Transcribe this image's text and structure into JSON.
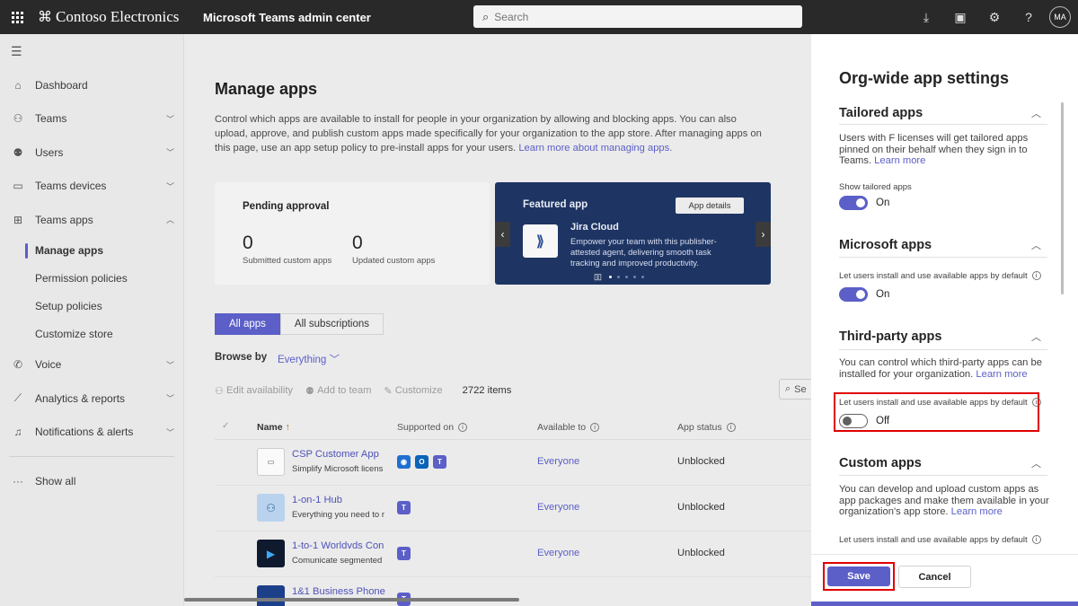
{
  "topbar": {
    "org_name": "Contoso Electronics",
    "product_name": "Microsoft Teams admin center",
    "search_placeholder": "Search",
    "avatar_initials": "MA"
  },
  "sidebar": {
    "items": [
      {
        "label": "Dashboard"
      },
      {
        "label": "Teams"
      },
      {
        "label": "Users"
      },
      {
        "label": "Teams devices"
      },
      {
        "label": "Teams apps"
      },
      {
        "label": "Voice"
      },
      {
        "label": "Analytics & reports"
      },
      {
        "label": "Notifications & alerts"
      }
    ],
    "subitems": [
      {
        "label": "Manage apps"
      },
      {
        "label": "Permission policies"
      },
      {
        "label": "Setup policies"
      },
      {
        "label": "Customize store"
      }
    ],
    "show_all": "Show all"
  },
  "main": {
    "title": "Manage apps",
    "description": "Control which apps are available to install for people in your organization by allowing and blocking apps. You can also upload, approve, and publish custom apps made specifically for your organization to the app store. After managing apps on this page, use an app setup policy to pre-install apps for your users.",
    "learn_more": "Learn more about managing apps.",
    "pending": {
      "title": "Pending approval",
      "submitted_count": "0",
      "submitted_label": "Submitted custom apps",
      "updated_count": "0",
      "updated_label": "Updated custom apps"
    },
    "featured": {
      "title": "Featured app",
      "button": "App details",
      "app_name": "Jira Cloud",
      "app_desc": "Empower your team with this publisher-attested agent, delivering smooth task tracking and improved productivity."
    },
    "tabs": [
      {
        "label": "All apps"
      },
      {
        "label": "All subscriptions"
      }
    ],
    "browse_label": "Browse by",
    "browse_value": "Everything",
    "toolbar": {
      "edit_availability": "Edit availability",
      "add_to_team": "Add to team",
      "customize": "Customize",
      "item_count": "2722 items",
      "search_partial": "Se"
    },
    "columns": {
      "name": "Name",
      "supported_on": "Supported on",
      "available_to": "Available to",
      "app_status": "App status"
    },
    "rows": [
      {
        "name": "CSP Customer App",
        "sub": "Simplify Microsoft licens",
        "available": "Everyone",
        "status": "Unblocked"
      },
      {
        "name": "1-on-1 Hub",
        "sub": "Everything you need to r",
        "available": "Everyone",
        "status": "Unblocked"
      },
      {
        "name": "1-to-1 Worldvds Con",
        "sub": "Comunicate segmented",
        "available": "Everyone",
        "status": "Unblocked"
      },
      {
        "name": "1&1 Business Phone",
        "sub": "",
        "available": "",
        "status": ""
      }
    ]
  },
  "panel": {
    "title": "Org-wide app settings",
    "tailored": {
      "heading": "Tailored apps",
      "text": "Users with F licenses will get tailored apps pinned on their behalf when they sign in to Teams.",
      "link": "Learn more",
      "toggle_label": "Show tailored apps",
      "state": "On"
    },
    "microsoft": {
      "heading": "Microsoft apps",
      "toggle_label": "Let users install and use available apps by default",
      "state": "On"
    },
    "third_party": {
      "heading": "Third-party apps",
      "text": "You can control which third-party apps can be installed for your organization.",
      "link": "Learn more",
      "toggle_label": "Let users install and use available apps by default",
      "state": "Off"
    },
    "custom": {
      "heading": "Custom apps",
      "text": "You can develop and upload custom apps as app packages and make them available in your organization's app store.",
      "link": "Learn more",
      "toggle_label": "Let users install and use available apps by default"
    },
    "save": "Save",
    "cancel": "Cancel"
  },
  "colors": {
    "accent": "#5b5fc7",
    "highlight": "#e00000",
    "topbar": "#292929",
    "featured_bg": "#1e3563"
  }
}
